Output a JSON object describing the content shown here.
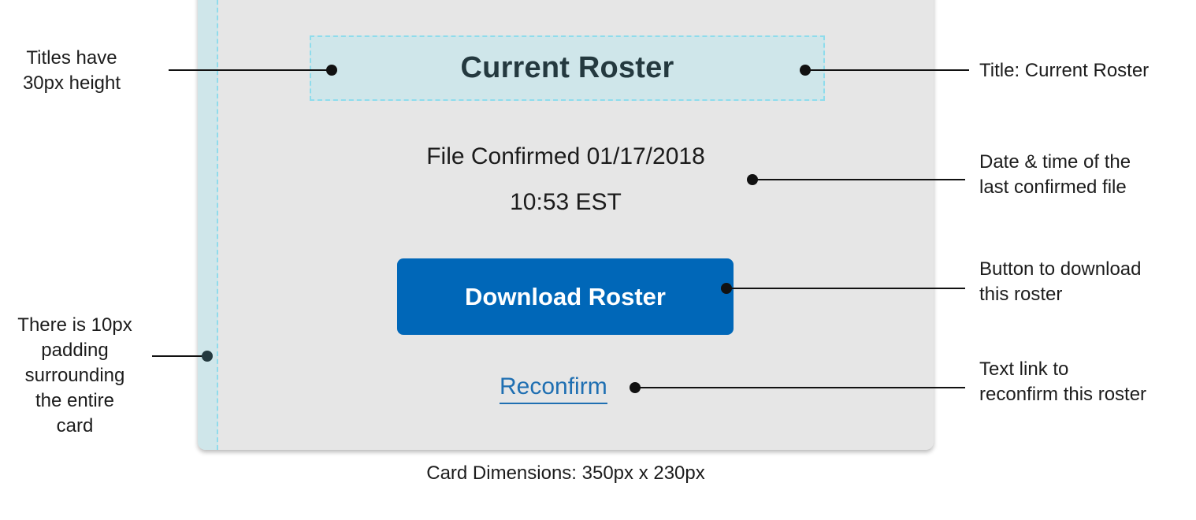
{
  "card": {
    "title": "Current Roster",
    "file_confirmed": "File Confirmed 01/17/2018",
    "confirmed_time": "10:53 EST",
    "download_button_label": "Download Roster",
    "reconfirm_link_label": "Reconfirm"
  },
  "annotations": {
    "title_height_line1": "Titles have",
    "title_height_line2": "30px height",
    "padding_line1": "There is 10px",
    "padding_line2": "padding",
    "padding_line3": "surrounding",
    "padding_line4": "the entire",
    "padding_line5": "card",
    "card_dimensions": "Card Dimensions: 350px x 230px",
    "title_label": "Title: Current Roster",
    "datetime_line1": "Date & time of the",
    "datetime_line2": "last confirmed file",
    "button_line1": "Button to download",
    "button_line2": "this roster",
    "link_line1": "Text link to",
    "link_line2": "reconfirm this roster"
  },
  "colors": {
    "card_background": "#e6e6e6",
    "guide_fill": "#cfe6ea",
    "guide_dash": "#8fdcec",
    "button_blue": "#0067b8",
    "link_blue": "#1f6fb2",
    "title_color": "#24393f"
  }
}
